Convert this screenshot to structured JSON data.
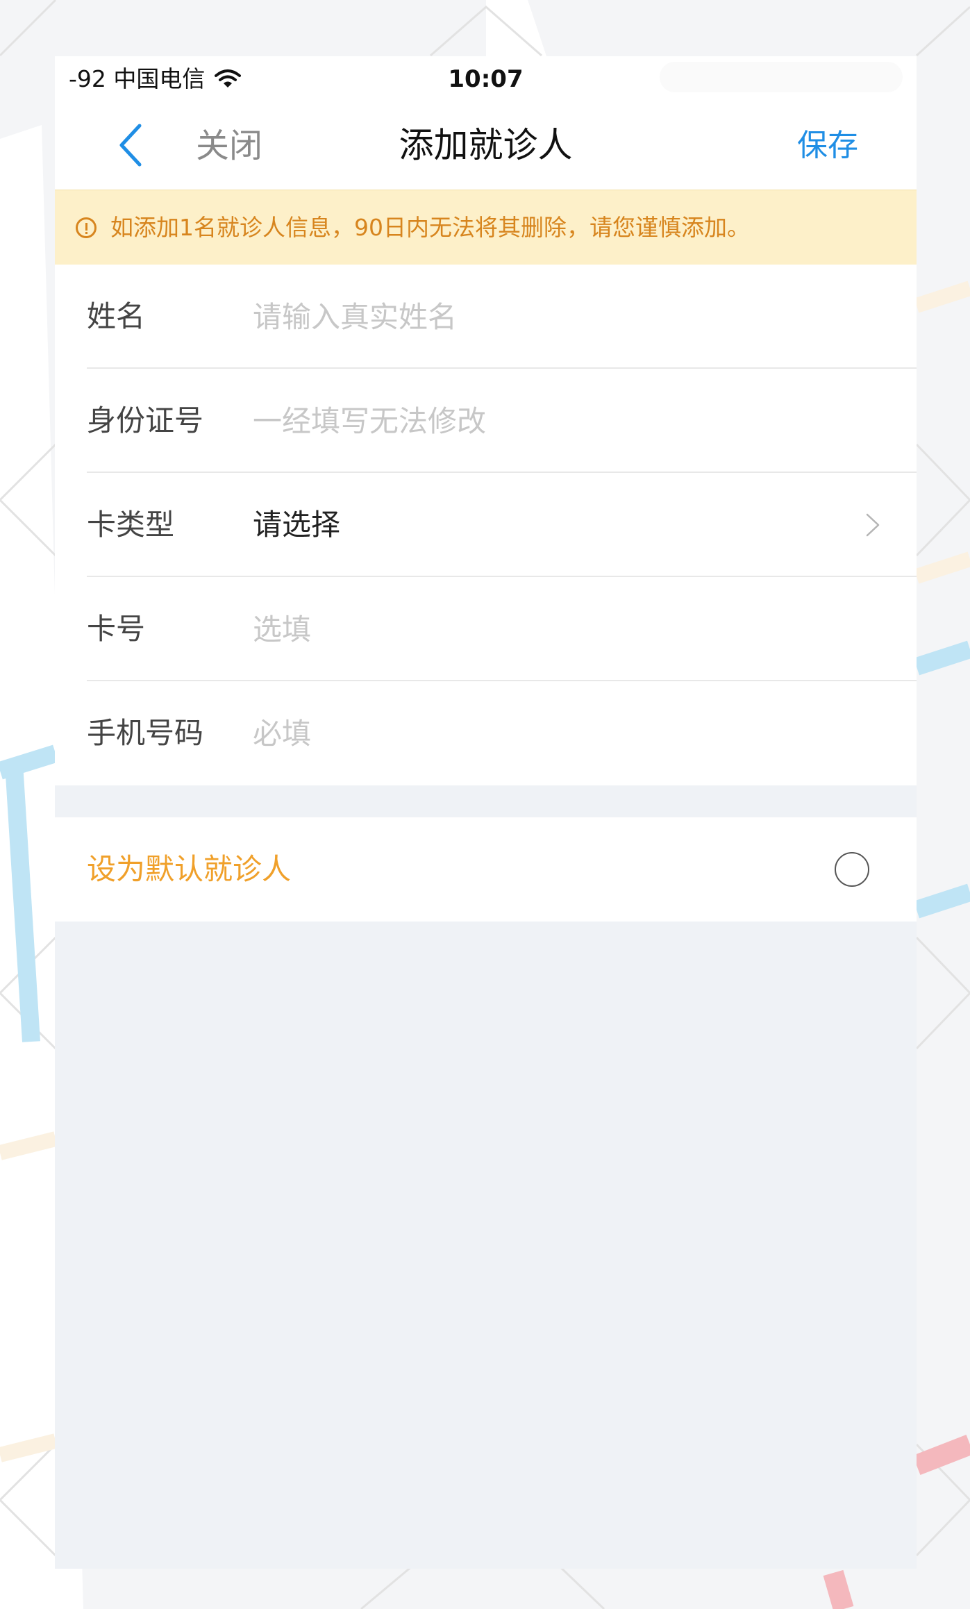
{
  "status_bar": {
    "carrier": "-92 中国电信",
    "time": "10:07"
  },
  "nav": {
    "close_label": "关闭",
    "title": "添加就诊人",
    "save_label": "保存"
  },
  "notice": {
    "text": "如添加1名就诊人信息，90日内无法将其删除，请您谨慎添加。"
  },
  "form": {
    "name": {
      "label": "姓名",
      "placeholder": "请输入真实姓名",
      "value": ""
    },
    "id_number": {
      "label": "身份证号",
      "placeholder": "一经填写无法修改",
      "value": ""
    },
    "card_type": {
      "label": "卡类型",
      "value": "请选择"
    },
    "card_number": {
      "label": "卡号",
      "placeholder": "选填",
      "value": ""
    },
    "phone": {
      "label": "手机号码",
      "placeholder": "必填",
      "value": ""
    }
  },
  "default_patient": {
    "label": "设为默认就诊人",
    "checked": false
  },
  "colors": {
    "accent": "#1f8ee5",
    "notice_bg": "#fdf0c9",
    "notice_text": "#d7851e",
    "default_label": "#f0a02a",
    "page_bg": "#eff2f6"
  }
}
